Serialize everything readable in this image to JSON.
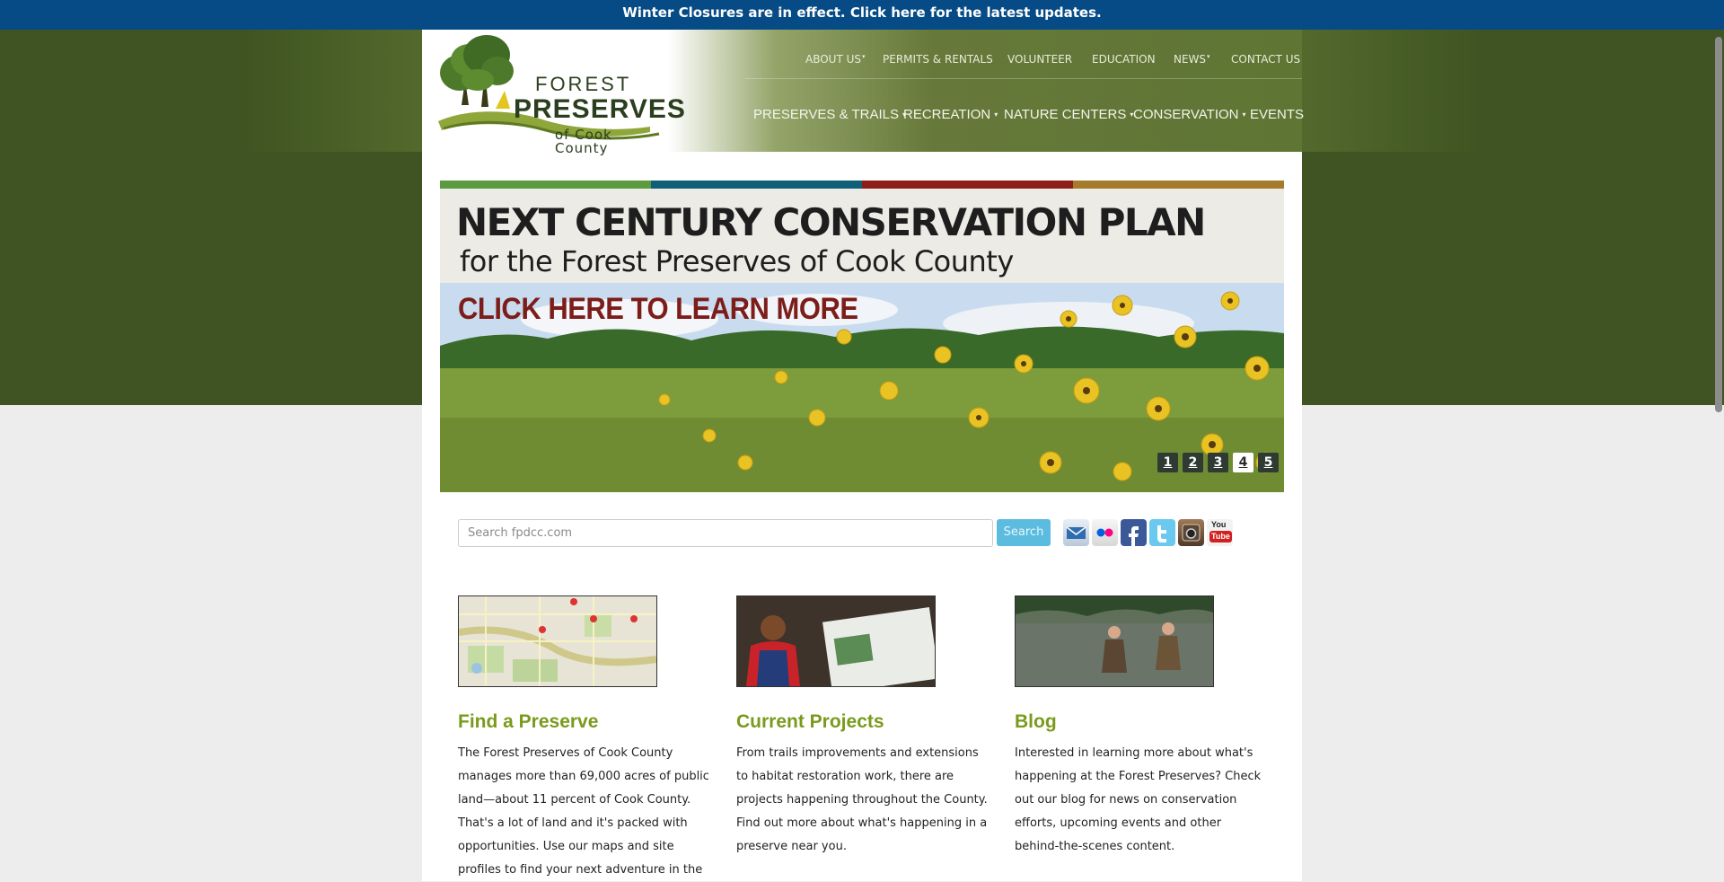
{
  "alert": {
    "text": "Winter Closures are in effect. Click here for the latest updates."
  },
  "logo": {
    "line1": "FOREST",
    "line2": "PRESERVES",
    "line3": "of Cook County"
  },
  "top_nav": [
    {
      "label": "ABOUT US",
      "caret": "▾"
    },
    {
      "label": "PERMITS & RENTALS"
    },
    {
      "label": "VOLUNTEER"
    },
    {
      "label": "EDUCATION"
    },
    {
      "label": "NEWS",
      "caret": "▾"
    },
    {
      "label": "CONTACT US"
    }
  ],
  "main_nav": [
    {
      "label": "PRESERVES & TRAILS",
      "caret": "▾"
    },
    {
      "label": "RECREATION",
      "caret": "▾"
    },
    {
      "label": "NATURE CENTERS",
      "caret": "▾"
    },
    {
      "label": "CONSERVATION",
      "caret": "▾"
    },
    {
      "label": "EVENTS"
    }
  ],
  "slider": {
    "title": "NEXT CENTURY CONSERVATION PLAN",
    "subtitle": "for the Forest Preserves of Cook County",
    "cta": "CLICK HERE TO LEARN MORE",
    "stripe_colors": [
      "#5b9a3f",
      "#0f5f78",
      "#8e1d1a",
      "#a57c2c"
    ],
    "pages": [
      "1",
      "2",
      "3",
      "4",
      "5"
    ],
    "active_page": "4"
  },
  "search": {
    "placeholder": "Search fpdcc.com",
    "button": "Search"
  },
  "social": [
    "email-icon",
    "flickr-icon",
    "facebook-icon",
    "twitter-icon",
    "instagram-icon",
    "youtube-icon"
  ],
  "youtube_text": {
    "you": "You",
    "tube": "Tube"
  },
  "features": [
    {
      "title": "Find a Preserve",
      "text": "The Forest Preserves of Cook County manages more than 69,000 acres of public land—about 11 percent of Cook County. That's a lot of land and it's packed with opportunities. Use our maps and site profiles to find your next adventure in the"
    },
    {
      "title": "Current Projects",
      "text": "From trails improvements and extensions to habitat restoration work, there are projects happening throughout the County. Find out more about what's happening in a preserve near you."
    },
    {
      "title": "Blog",
      "text": "Interested in learning more about what's happening at the Forest Preserves? Check out our blog for news on conservation efforts, upcoming events and other behind-the-scenes content."
    }
  ]
}
